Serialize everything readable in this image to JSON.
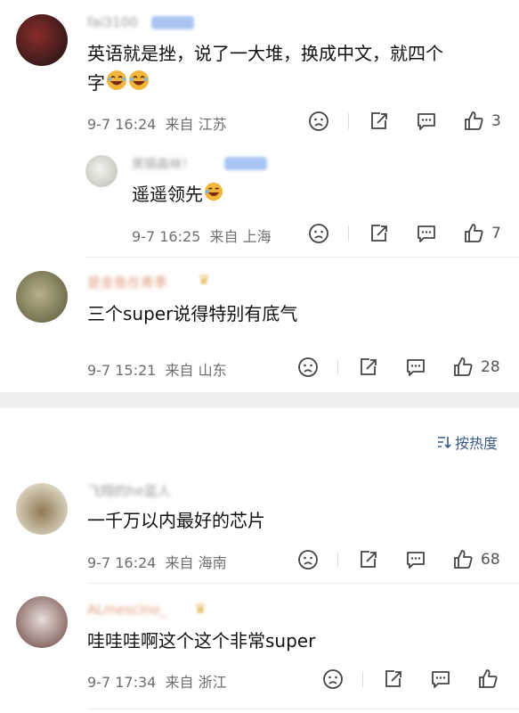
{
  "sort_label": "按热度",
  "comments": [
    {
      "username": "fai3100",
      "text": "英语就是挫，说了一大堆，换成中文，就四个字",
      "text_line1": "英语就是挫，说了一大堆，换成中文，就四个",
      "text_line2": "字",
      "emojis": [
        "laughing-crying-icon",
        "laughing-crying-icon"
      ],
      "date": "9-7 16:24",
      "location": "来自 江苏",
      "likes": "3"
    },
    {
      "username": "黑锅森林！",
      "text": "遥遥领先",
      "emojis": [
        "laughing-crying-icon"
      ],
      "date": "9-7 16:25",
      "location": "来自 上海",
      "likes": "7",
      "reply": true
    },
    {
      "username": "是金鱼在青季",
      "text": "三个super说得特别有底气",
      "date": "9-7 15:21",
      "location": "来自 山东",
      "likes": "28"
    },
    {
      "username": "飞翔的he蓝人",
      "text": "一千万以内最好的芯片",
      "date": "9-7 16:24",
      "location": "来自 海南",
      "likes": "68"
    },
    {
      "username": "ALmescino_",
      "text": "哇哇哇啊这个这个非常super",
      "date": "9-7 17:34",
      "location": "来自 浙江",
      "likes": ""
    }
  ],
  "colors": {
    "accent_link": "#3a5a88",
    "meta_gray": "#6e6e6e",
    "badge_blue": "#a9c6f2",
    "crown_gold": "#e9b85c"
  }
}
